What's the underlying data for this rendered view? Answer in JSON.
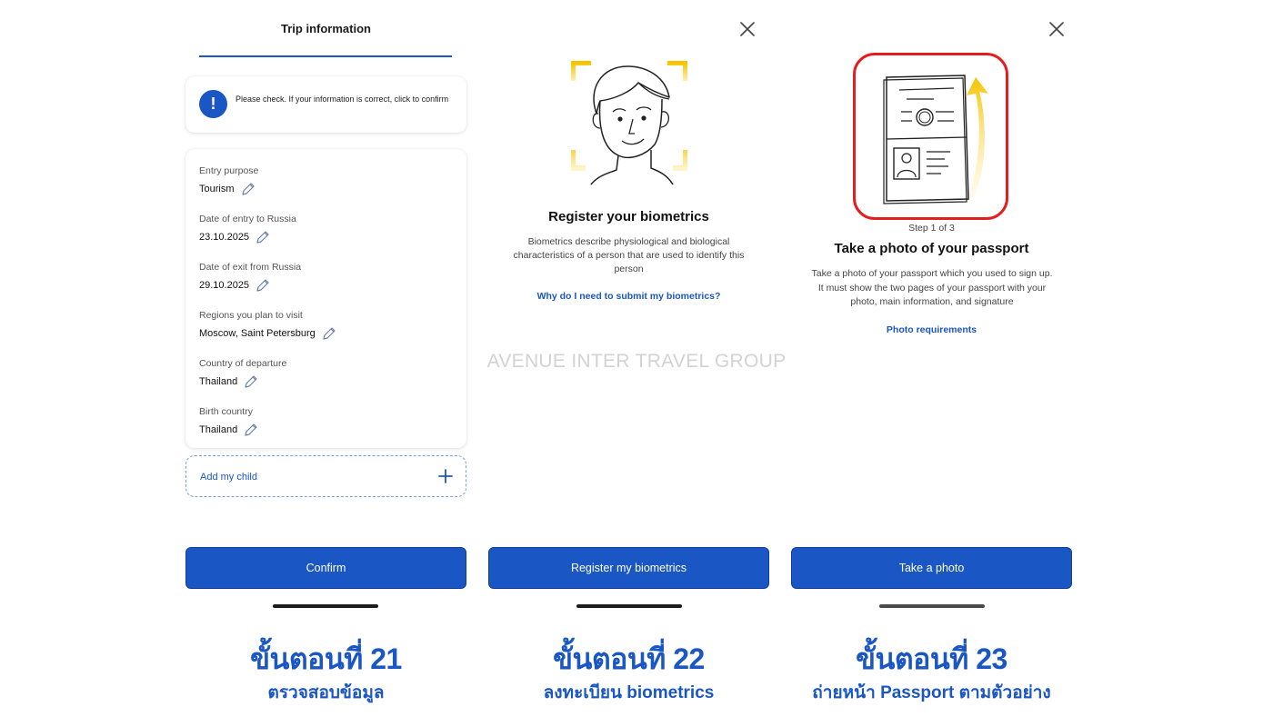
{
  "watermark": "AVENUE INTER TRAVEL GROUP",
  "panel1": {
    "title": "Trip information",
    "notice_text": "Please check. If your information is correct, click to confirm",
    "fields": [
      {
        "label": "Entry purpose",
        "value": "Tourism"
      },
      {
        "label": "Date of entry to Russia",
        "value": "23.10.2025"
      },
      {
        "label": "Date of exit from Russia",
        "value": "29.10.2025"
      },
      {
        "label": "Regions you plan to visit",
        "value": "Moscow, Saint Petersburg"
      },
      {
        "label": "Country of departure",
        "value": "Thailand"
      },
      {
        "label": "Birth country",
        "value": "Thailand"
      }
    ],
    "add_child_label": "Add my child",
    "button_label": "Confirm",
    "caption_title": "ขั้นตอนที่ 21",
    "caption_sub": "ตรวจสอบข้อมูล"
  },
  "panel2": {
    "title": "Register your biometrics",
    "description": "Biometrics describe physiological and biological characteristics of a person that are used to identify this person",
    "link": "Why do I need to submit my biometrics?",
    "button_label": "Register my biometrics",
    "caption_title": "ขั้นตอนที่ 22",
    "caption_sub": "ลงทะเบียน biometrics"
  },
  "panel3": {
    "step": "Step 1 of 3",
    "title": "Take a photo of your passport",
    "description": "Take a photo of your passport which you used to sign up. It must show the two pages of your passport with your photo, main information, and signature",
    "link": "Photo requirements",
    "button_label": "Take a photo",
    "caption_title": "ขั้นตอนที่ 23",
    "caption_sub": "ถ่ายหน้า Passport ตามตัวอย่าง"
  },
  "colors": {
    "accent": "#1a56c4",
    "highlight_frame": "#e41e1e",
    "face_frame": "#f5c400",
    "arrow": "#f5c400"
  },
  "icons": {
    "notice": "exclamation-icon",
    "edit": "pencil-icon",
    "add": "plus-icon",
    "close": "close-icon"
  }
}
